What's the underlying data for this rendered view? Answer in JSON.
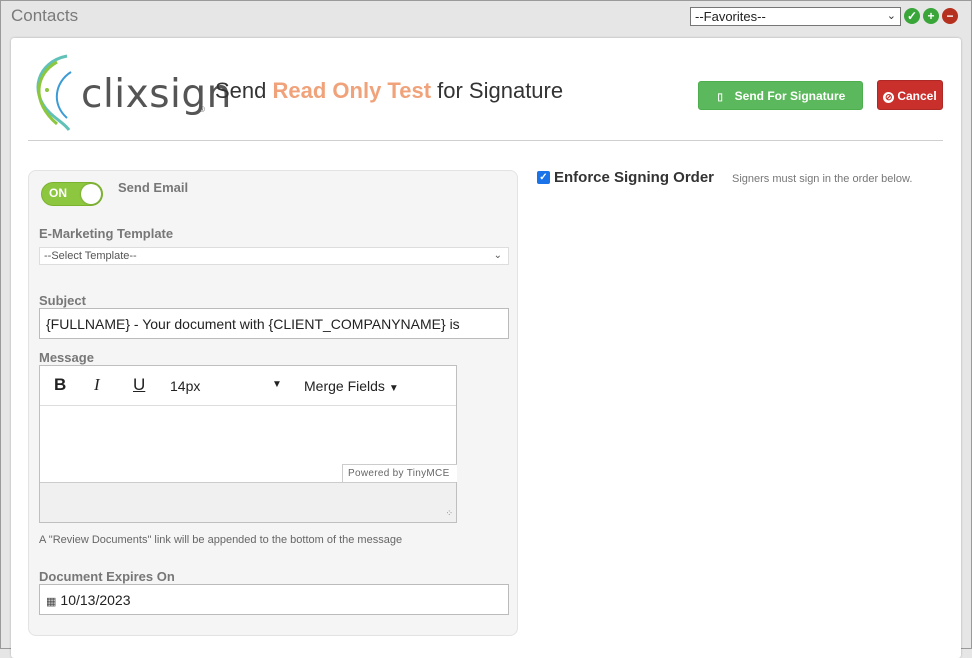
{
  "topbar": {
    "title": "Contacts",
    "favorites_value": "--Favorites--"
  },
  "colors": {
    "accent_green": "#5cb85c",
    "danger_red": "#c9302c",
    "highlight_orange": "#f0a27a",
    "toggle_green": "#8dc63f"
  },
  "header": {
    "logo_text": "clixsign",
    "logo_mark": "®",
    "title_prefix": "Send ",
    "title_highlight": "Read Only Test",
    "title_suffix": " for Signature",
    "send_button": "Send For Signature",
    "send_icon": "paper-plane-icon",
    "cancel_button": "Cancel",
    "cancel_icon": "ban-icon"
  },
  "email": {
    "toggle_label": "ON",
    "toggle_state": "on",
    "send_email_label": "Send Email",
    "template_label": "E-Marketing Template",
    "template_value": "--Select Template--",
    "subject_label": "Subject",
    "subject_value": "{FULLNAME} - Your document with {CLIENT_COMPANYNAME} is",
    "message_label": "Message",
    "editor": {
      "bold": "B",
      "italic": "I",
      "underline": "U",
      "font_size": "14px",
      "merge_fields": "Merge Fields",
      "powered_by": "Powered by TinyMCE"
    },
    "note": "A \"Review Documents\" link will be appended to the bottom of the message",
    "expires_label": "Document Expires On",
    "expires_value": "10/13/2023"
  },
  "signing": {
    "enforce_checked": true,
    "enforce_label": "Enforce Signing Order",
    "enforce_help": "Signers must sign in the order below."
  }
}
